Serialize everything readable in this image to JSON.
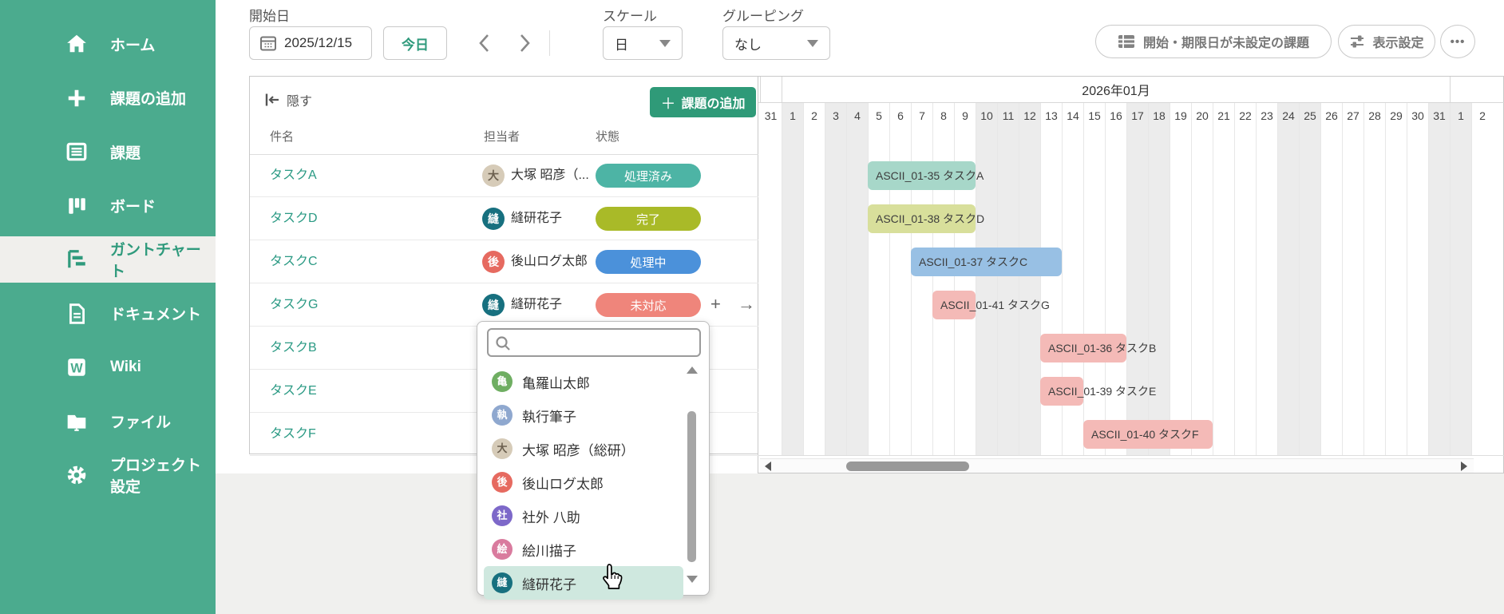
{
  "sidebar": {
    "items": [
      {
        "id": "home",
        "label": "ホーム"
      },
      {
        "id": "add-issue",
        "label": "課題の追加"
      },
      {
        "id": "issues",
        "label": "課題"
      },
      {
        "id": "board",
        "label": "ボード"
      },
      {
        "id": "gantt",
        "label": "ガントチャート",
        "active": true
      },
      {
        "id": "documents",
        "label": "ドキュメント"
      },
      {
        "id": "wiki",
        "label": "Wiki"
      },
      {
        "id": "files",
        "label": "ファイル"
      },
      {
        "id": "project-settings",
        "label": "プロジェクト設定"
      }
    ]
  },
  "toolbar": {
    "start_date_label": "開始日",
    "date_value": "2025/12/15",
    "today_label": "今日",
    "scale_label": "スケール",
    "scale_value": "日",
    "grouping_label": "グルーピング",
    "grouping_value": "なし",
    "unset_issues_label": "開始・期限日が未設定の課題",
    "display_settings_label": "表示設定",
    "more_label": "•••"
  },
  "panel": {
    "hide_label": "隠す",
    "add_issue_label": "課題の追加",
    "columns": [
      "件名",
      "担当者",
      "状態"
    ]
  },
  "table_rows": [
    {
      "subject": "タスクA",
      "assignee": "大塚 昭彦（...",
      "avatar_char": "大",
      "avatar_color": "#d6cbb8",
      "avatar_text": "#6b5f4e",
      "status": "処理済み",
      "status_color": "#4db4a5"
    },
    {
      "subject": "タスクD",
      "assignee": "縫研花子",
      "avatar_char": "縫",
      "avatar_color": "#17707f",
      "avatar_text": "#ffffff",
      "status": "完了",
      "status_color": "#a9ba28"
    },
    {
      "subject": "タスクC",
      "assignee": "後山ログ太郎",
      "avatar_char": "後",
      "avatar_color": "#e66a60",
      "avatar_text": "#ffffff",
      "status": "処理中",
      "status_color": "#4b91da"
    },
    {
      "subject": "タスクG",
      "assignee": "縫研花子",
      "avatar_char": "縫",
      "avatar_color": "#17707f",
      "avatar_text": "#ffffff",
      "status": "未対応",
      "status_color": "#ef857b",
      "actions": [
        "+",
        "→"
      ]
    },
    {
      "subject": "タスクB",
      "covered": true
    },
    {
      "subject": "タスクE",
      "covered": true
    },
    {
      "subject": "タスクF",
      "covered": true
    }
  ],
  "gantt": {
    "month_label": "2026年01月",
    "days": [
      {
        "label": "31",
        "off": false
      },
      {
        "label": "1",
        "off": true
      },
      {
        "label": "2",
        "off": false
      },
      {
        "label": "3",
        "off": true
      },
      {
        "label": "4",
        "off": true
      },
      {
        "label": "5",
        "off": false
      },
      {
        "label": "6",
        "off": false
      },
      {
        "label": "7",
        "off": false
      },
      {
        "label": "8",
        "off": false
      },
      {
        "label": "9",
        "off": false
      },
      {
        "label": "10",
        "off": true
      },
      {
        "label": "11",
        "off": true
      },
      {
        "label": "12",
        "off": true
      },
      {
        "label": "13",
        "off": false
      },
      {
        "label": "14",
        "off": false
      },
      {
        "label": "15",
        "off": false
      },
      {
        "label": "16",
        "off": false
      },
      {
        "label": "17",
        "off": true
      },
      {
        "label": "18",
        "off": true
      },
      {
        "label": "19",
        "off": false
      },
      {
        "label": "20",
        "off": false
      },
      {
        "label": "21",
        "off": false
      },
      {
        "label": "22",
        "off": false
      },
      {
        "label": "23",
        "off": false
      },
      {
        "label": "24",
        "off": true
      },
      {
        "label": "25",
        "off": true
      },
      {
        "label": "26",
        "off": false
      },
      {
        "label": "27",
        "off": false
      },
      {
        "label": "28",
        "off": false
      },
      {
        "label": "29",
        "off": false
      },
      {
        "label": "30",
        "off": false
      },
      {
        "label": "31",
        "off": true
      },
      {
        "label": "1",
        "off": true
      },
      {
        "label": "2",
        "off": false
      }
    ],
    "bars": [
      {
        "row": 0,
        "label": "ASCII_01-35  タスクA",
        "start": 5,
        "end": 9,
        "color": "#a7d7c9"
      },
      {
        "row": 1,
        "label": "ASCII_01-38  タスクD",
        "start": 5,
        "end": 9,
        "color": "#d8df9b"
      },
      {
        "row": 2,
        "label": "ASCII_01-37  タスクC",
        "start": 7,
        "end": 13,
        "color": "#98c0e4"
      },
      {
        "row": 3,
        "label": "ASCII_01-41  タスクG",
        "start": 8,
        "end": 9,
        "color": "#f4bab7"
      },
      {
        "row": 4,
        "label": "ASCII_01-36  タスクB",
        "start": 13,
        "end": 16,
        "color": "#f4bab7"
      },
      {
        "row": 5,
        "label": "ASCII_01-39  タスクE",
        "start": 13,
        "end": 14,
        "color": "#f4bab7"
      },
      {
        "row": 6,
        "label": "ASCII_01-40  タスクF",
        "start": 15,
        "end": 20,
        "color": "#f4bab7"
      }
    ]
  },
  "dropdown": {
    "search_value": "",
    "items": [
      {
        "name": "亀羅山太郎",
        "avatar_char": "亀",
        "avatar_color": "#6fae62",
        "avatar_text": "#ffffff"
      },
      {
        "name": "執行筆子",
        "avatar_char": "執",
        "avatar_color": "#8fa8cf",
        "avatar_text": "#ffffff"
      },
      {
        "name": "大塚 昭彦（総研）",
        "avatar_char": "大",
        "avatar_color": "#d6cbb8",
        "avatar_text": "#6b5f4e"
      },
      {
        "name": "後山ログ太郎",
        "avatar_char": "後",
        "avatar_color": "#e66a60",
        "avatar_text": "#ffffff"
      },
      {
        "name": "社外 八助",
        "avatar_char": "社",
        "avatar_color": "#7d68c9",
        "avatar_text": "#ffffff"
      },
      {
        "name": "絵川描子",
        "avatar_char": "絵",
        "avatar_color": "#d97b9e",
        "avatar_text": "#ffffff"
      },
      {
        "name": "縫研花子",
        "avatar_char": "縫",
        "avatar_color": "#17707f",
        "avatar_text": "#ffffff",
        "highlighted": true
      }
    ]
  }
}
